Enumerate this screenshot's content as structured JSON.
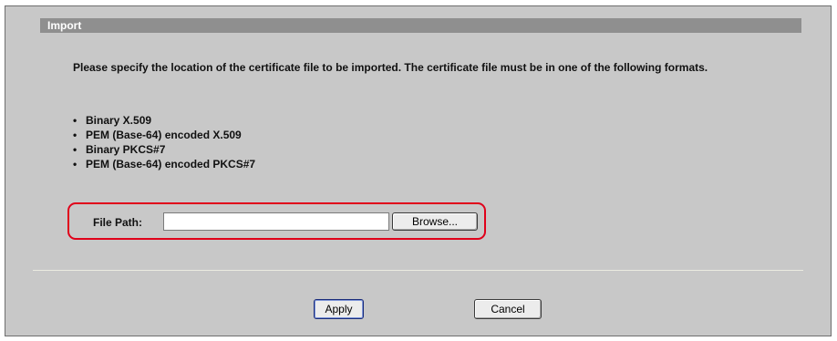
{
  "section": {
    "title": "Import"
  },
  "instructions": "Please specify the location of the certificate file to be imported. The certificate file must be in one of the following formats.",
  "formats": [
    "Binary X.509",
    "PEM (Base-64) encoded X.509",
    "Binary PKCS#7",
    "PEM (Base-64) encoded PKCS#7"
  ],
  "file_path": {
    "label": "File Path:",
    "value": "",
    "browse_label": "Browse..."
  },
  "actions": {
    "apply_label": "Apply",
    "cancel_label": "Cancel"
  },
  "colors": {
    "panel_background": "#c8c8c8",
    "header_background": "#8f8f8f",
    "highlight_border": "#e0001a"
  }
}
